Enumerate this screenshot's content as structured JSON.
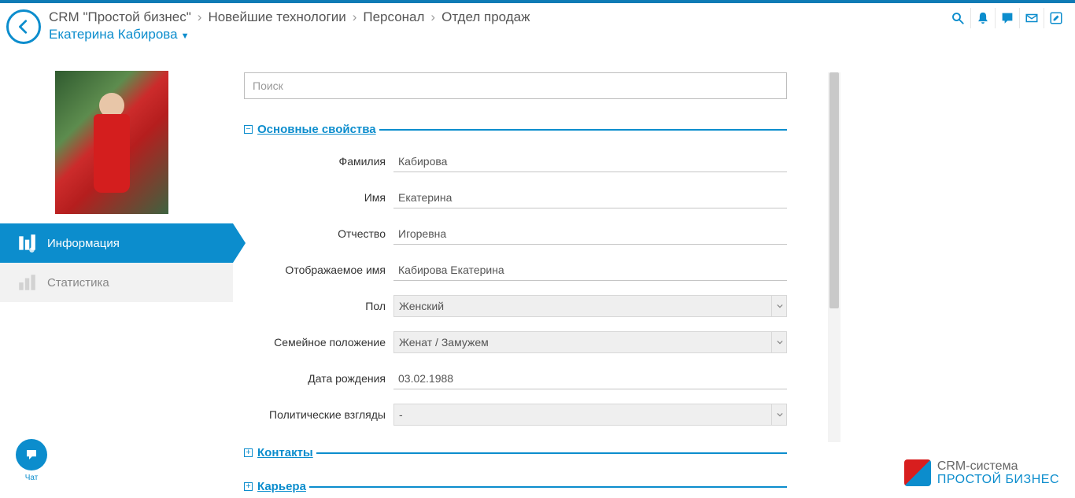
{
  "breadcrumb": {
    "app": "CRM \"Простой бизнес\"",
    "level1": "Новейшие технологии",
    "level2": "Персонал",
    "level3": "Отдел продаж",
    "sub": "Екатерина Кабирова"
  },
  "sidebar": {
    "tabs": [
      {
        "label": "Информация",
        "active": true
      },
      {
        "label": "Статистика",
        "active": false
      }
    ]
  },
  "form": {
    "search_placeholder": "Поиск",
    "sections": {
      "main": {
        "title": "Основные свойства",
        "fields": {
          "last_name": {
            "label": "Фамилия",
            "value": "Кабирова"
          },
          "first_name": {
            "label": "Имя",
            "value": "Екатерина"
          },
          "patronymic": {
            "label": "Отчество",
            "value": "Игоревна"
          },
          "display_name": {
            "label": "Отображаемое имя",
            "value": "Кабирова Екатерина"
          },
          "gender": {
            "label": "Пол",
            "value": "Женский"
          },
          "marital": {
            "label": "Семейное положение",
            "value": "Женат / Замужем"
          },
          "birthdate": {
            "label": "Дата рождения",
            "value": "03.02.1988"
          },
          "political": {
            "label": "Политические взгляды",
            "value": "-"
          }
        }
      },
      "contacts": {
        "title": "Контакты"
      },
      "career": {
        "title": "Карьера"
      }
    }
  },
  "chat": {
    "label": "Чат"
  },
  "product": {
    "line1": "CRM-система",
    "line2": "ПРОСТОЙ БИЗНЕС"
  }
}
